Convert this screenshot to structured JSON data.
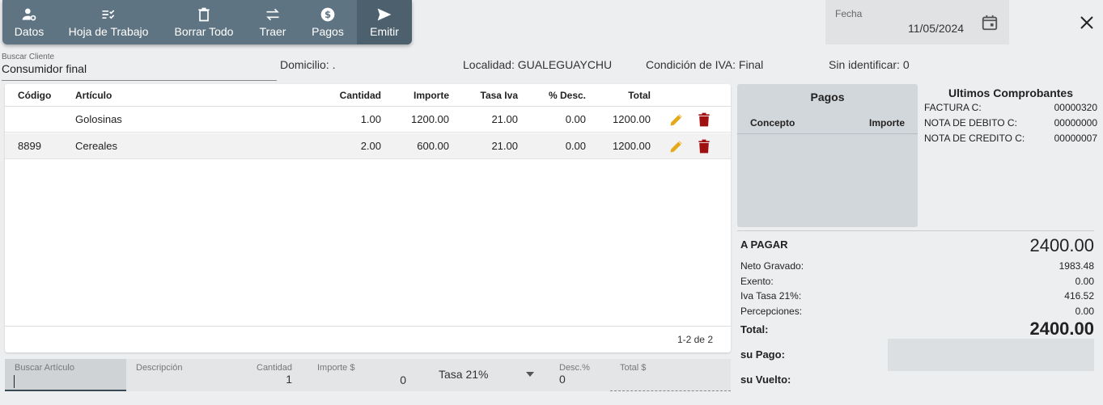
{
  "toolbar": {
    "buttons": [
      {
        "label": "Datos",
        "icon": "person-gear-icon"
      },
      {
        "label": "Hoja de Trabajo",
        "icon": "checklist-icon"
      },
      {
        "label": "Borrar Todo",
        "icon": "trash-icon"
      },
      {
        "label": "Traer",
        "icon": "swap-icon"
      },
      {
        "label": "Pagos",
        "icon": "dollar-circle-icon"
      },
      {
        "label": "Emitir",
        "icon": "send-icon"
      }
    ]
  },
  "fecha": {
    "label": "Fecha",
    "value": "11/05/2024"
  },
  "client": {
    "search_label": "Buscar Cliente",
    "name": "Consumidor final",
    "domicilio": "Domicilio: .",
    "localidad": "Localidad: GUALEGUAYCHU",
    "condicion_iva": "Condición de IVA: Final",
    "sin_identificar": "Sin identificar: 0"
  },
  "table": {
    "headers": {
      "codigo": "Código",
      "articulo": "Artículo",
      "cantidad": "Cantidad",
      "importe": "Importe",
      "tasa_iva": "Tasa Iva",
      "desc": "% Desc.",
      "total": "Total"
    },
    "rows": [
      {
        "codigo": "",
        "articulo": "Golosinas",
        "cantidad": "1.00",
        "importe": "1200.00",
        "tasa_iva": "21.00",
        "desc": "0.00",
        "total": "1200.00"
      },
      {
        "codigo": "8899",
        "articulo": "Cereales",
        "cantidad": "2.00",
        "importe": "600.00",
        "tasa_iva": "21.00",
        "desc": "0.00",
        "total": "1200.00"
      }
    ],
    "pagination": "1-2 de 2"
  },
  "input_row": {
    "buscar_articulo": {
      "label": "Buscar Artículo",
      "value": ""
    },
    "descripcion": {
      "label": "Descripción",
      "value": ""
    },
    "cantidad": {
      "label": "Cantidad",
      "value": "1"
    },
    "importe": {
      "label": "Importe $",
      "value": "0"
    },
    "tasa": {
      "value": "Tasa 21%"
    },
    "desc": {
      "label": "Desc.%",
      "value": "0"
    },
    "total": {
      "label": "Total $",
      "value": ""
    }
  },
  "pagos": {
    "title": "Pagos",
    "col_concepto": "Concepto",
    "col_importe": "Importe"
  },
  "ultimos_comprobantes": {
    "title": "Ultimos Comprobantes",
    "items": [
      {
        "label": "FACTURA C:",
        "value": "00000320"
      },
      {
        "label": "NOTA DE DEBITO C:",
        "value": "00000000"
      },
      {
        "label": "NOTA DE CREDITO C:",
        "value": "00000007"
      }
    ]
  },
  "totals": {
    "a_pagar_label": "A PAGAR",
    "a_pagar_value": "2400.00",
    "neto_label": "Neto Gravado:",
    "neto_value": "1983.48",
    "exento_label": "Exento:",
    "exento_value": "0.00",
    "iva_label": "Iva Tasa 21%:",
    "iva_value": "416.52",
    "percep_label": "Percepciones:",
    "percep_value": "0.00",
    "total_label": "Total:",
    "total_value": "2400.00",
    "su_pago_label": "su Pago:",
    "su_vuelto_label": "su Vuelto:"
  },
  "colors": {
    "toolbar": "#5f7482",
    "edit_icon": "#e6a817",
    "delete_icon": "#a01010"
  }
}
